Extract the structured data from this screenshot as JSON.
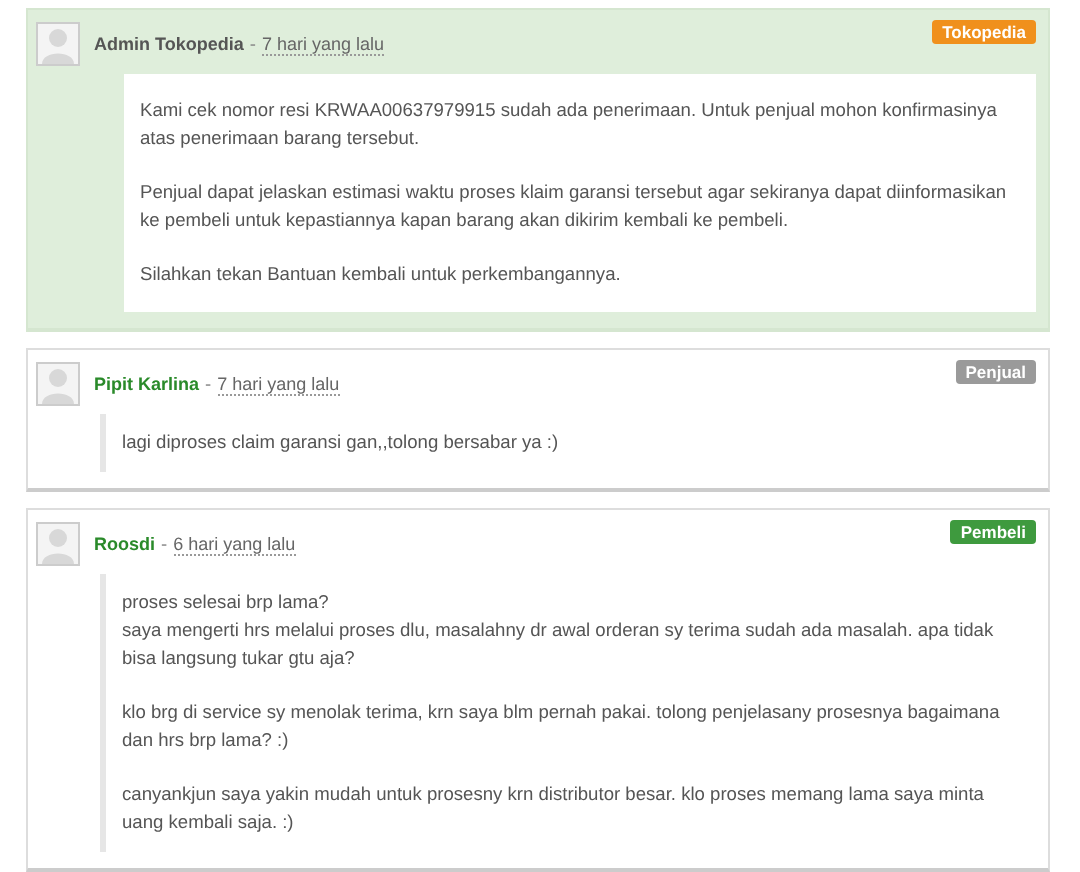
{
  "comments": [
    {
      "kind": "admin",
      "author": "Admin Tokopedia",
      "separator": "-",
      "time": "7 hari yang lalu",
      "badge": "Tokopedia",
      "paragraphs": [
        "Kami cek nomor resi KRWAA00637979915 sudah ada penerimaan. Untuk penjual mohon konfirmasinya atas penerimaan barang tersebut.",
        "Penjual dapat jelaskan estimasi waktu proses klaim garansi tersebut agar sekiranya dapat diinformasikan ke pembeli untuk kepastiannya kapan barang akan dikirim kembali ke pembeli.",
        "Silahkan tekan Bantuan kembali untuk perkembangannya."
      ]
    },
    {
      "kind": "seller",
      "author": "Pipit Karlina",
      "separator": "-",
      "time": "7 hari yang lalu",
      "badge": "Penjual",
      "paragraphs": [
        "lagi diproses claim garansi gan,,tolong bersabar ya :)"
      ]
    },
    {
      "kind": "buyer",
      "author": "Roosdi",
      "separator": "-",
      "time": "6 hari yang lalu",
      "badge": "Pembeli",
      "paragraphs": [
        "proses selesai brp lama?\nsaya mengerti hrs melalui proses dlu, masalahny dr awal orderan sy terima sudah ada masalah. apa tidak bisa langsung tukar gtu aja?",
        "klo brg di service sy menolak terima, krn saya blm pernah pakai. tolong penjelasany prosesnya bagaimana dan hrs brp lama? :)",
        "canyankjun saya yakin mudah untuk prosesny krn distributor besar. klo proses memang lama saya minta uang kembali saja. :)"
      ]
    }
  ]
}
